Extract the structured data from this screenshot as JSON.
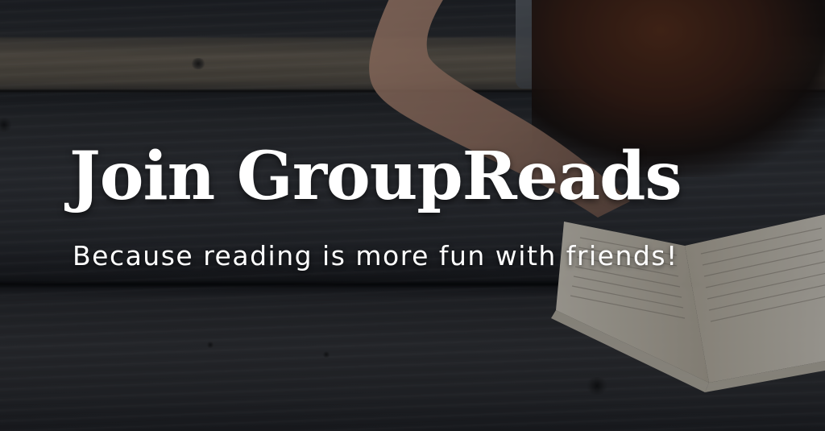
{
  "hero": {
    "title": "Join GroupReads",
    "tagline": "Because reading is more fun with friends!"
  },
  "background": {
    "subject": "person reading an open book on a weathered wooden table",
    "colors": {
      "wood_dark": "#2b2d30",
      "wood_light": "#6b6254",
      "text": "#ffffff",
      "overlay": "#0a0c10"
    }
  }
}
